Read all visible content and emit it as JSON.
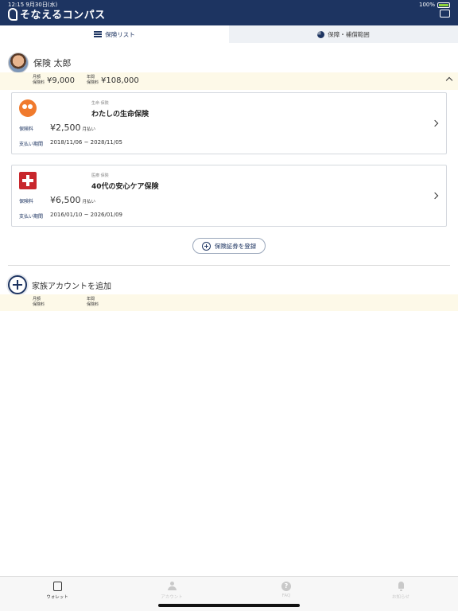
{
  "status_bar": {
    "time": "12:15",
    "date": "9月30日(水)",
    "battery": "100%"
  },
  "app": {
    "title": "そなえるコンパス"
  },
  "tabs": [
    {
      "label": "保険リスト",
      "icon": "list-icon",
      "active": true
    },
    {
      "label": "保障・補償範囲",
      "icon": "pie-chart-icon",
      "active": false
    }
  ],
  "member": {
    "name": "保険 太郎",
    "monthly_label_1": "月額",
    "monthly_label_2": "保険料",
    "monthly_value": "¥9,000",
    "annual_label_1": "年間",
    "annual_label_2": "保険料",
    "annual_value": "¥108,000"
  },
  "policies": [
    {
      "category": "生命 保険",
      "title": "わたしの生命保険",
      "premium_label": "保険料",
      "premium": "¥2,500",
      "premium_unit": "月払い",
      "period_label": "支払い期間",
      "period": "2018/11/06 ~ 2028/11/05",
      "icon": "life-insurance-icon",
      "icon_color": "#f07a2d"
    },
    {
      "category": "医療 保険",
      "title": "40代の安心ケア保険",
      "premium_label": "保険料",
      "premium": "¥6,500",
      "premium_unit": "月払い",
      "period_label": "支払い期間",
      "period": "2016/01/10 ~ 2026/01/09",
      "icon": "medical-cross-icon",
      "icon_color": "#c8262c"
    }
  ],
  "register_button": {
    "label": "保険証券を登録"
  },
  "family": {
    "label": "家族アカウントを追加",
    "monthly_label_1": "月額",
    "monthly_label_2": "保険料",
    "annual_label_1": "年間",
    "annual_label_2": "保険料"
  },
  "bottom_nav": [
    {
      "label": "ウォレット",
      "icon": "wallet-icon",
      "active": true
    },
    {
      "label": "アカウント",
      "icon": "person-icon",
      "active": false
    },
    {
      "label": "FAQ",
      "icon": "faq-icon",
      "active": false
    },
    {
      "label": "お知らせ",
      "icon": "bell-icon",
      "active": false
    }
  ],
  "colors": {
    "brand": "#1d3461",
    "summary_bg": "#fdf9e8",
    "inactive_tab": "#eef1f5"
  }
}
